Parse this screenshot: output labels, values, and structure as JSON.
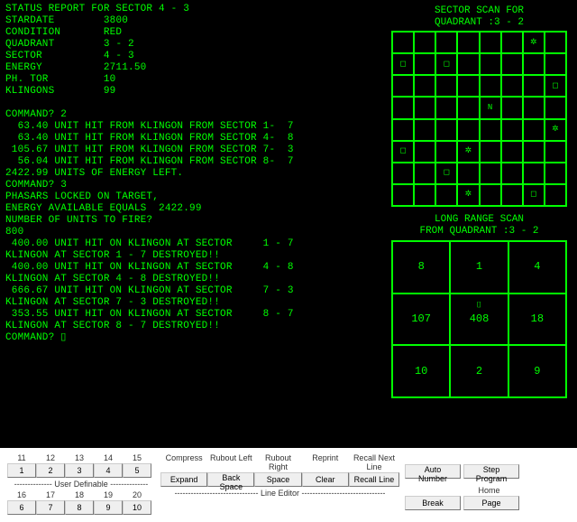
{
  "report": {
    "header": "STATUS REPORT FOR SECTOR 4 - 3",
    "stardate_label": "STARDATE",
    "stardate": "3800",
    "condition_label": "CONDITION",
    "condition": "RED",
    "quadrant_label": "QUADRANT",
    "quadrant": "3 - 2",
    "sector_label": "SECTOR",
    "sector": "4 - 3",
    "energy_label": "ENERGY",
    "energy": "2711.50",
    "phtor_label": "PH. TOR",
    "phtor": "10",
    "klingons_label": "KLINGONS",
    "klingons": "99"
  },
  "log": {
    "cmd1": "COMMAND? 2",
    "hit1": "  63.40 UNIT HIT FROM KLINGON FROM SECTOR 1-  7",
    "hit2": "  63.40 UNIT HIT FROM KLINGON FROM SECTOR 4-  8",
    "hit3": " 105.67 UNIT HIT FROM KLINGON FROM SECTOR 7-  3",
    "hit4": "  56.04 UNIT HIT FROM KLINGON FROM SECTOR 8-  7",
    "energyleft": "2422.99 UNITS OF ENERGY LEFT.",
    "cmd2": "COMMAND? 3",
    "lock": "PHASARS LOCKED ON TARGET,",
    "avail": "ENERGY AVAILABLE EQUALS  2422.99",
    "fireprompt": "NUMBER OF UNITS TO FIRE?",
    "fireval": "800",
    "o1": " 400.00 UNIT HIT ON KLINGON AT SECTOR     1 - 7",
    "d1": "KLINGON AT SECTOR 1 - 7 DESTROYED!!",
    "o2": " 400.00 UNIT HIT ON KLINGON AT SECTOR     4 - 8",
    "d2": "KLINGON AT SECTOR 4 - 8 DESTROYED!!",
    "o3": " 666.67 UNIT HIT ON KLINGON AT SECTOR     7 - 3",
    "d3": "KLINGON AT SECTOR 7 - 3 DESTROYED!!",
    "o4": " 353.55 UNIT HIT ON KLINGON AT SECTOR     8 - 7",
    "d4": "KLINGON AT SECTOR 8 - 7 DESTROYED!!",
    "cmd3_label": "COMMAND? ",
    "cursor": "▯"
  },
  "sector_scan": {
    "title1": "SECTOR SCAN FOR",
    "title2": "QUADRANT :3 - 2",
    "cells": {
      "r1c7": "✲",
      "r2c1": "◻",
      "r2c3": "◻",
      "r3c8": "◻",
      "r4c5": "N",
      "r5c8": "✲",
      "r6c1": "◻",
      "r6c4": "✲",
      "r7c3": "◻",
      "r8c4": "✲",
      "r8c7": "◻"
    }
  },
  "long_range": {
    "title1": "LONG RANGE SCAN",
    "title2": "FROM QUADRANT :3 - 2",
    "cells": [
      "8",
      "1",
      "4",
      "107",
      "408",
      "18",
      "10",
      "2",
      "9"
    ],
    "ship_marker": "⌷"
  },
  "keypad": {
    "top_labels": [
      "11",
      "12",
      "13",
      "14",
      "15"
    ],
    "top_buttons": [
      "1",
      "2",
      "3",
      "4",
      "5"
    ],
    "sep": "-------------- User Definable --------------",
    "bot_labels": [
      "16",
      "17",
      "18",
      "19",
      "20"
    ],
    "bot_buttons": [
      "6",
      "7",
      "8",
      "9",
      "10"
    ]
  },
  "editor": {
    "top_labels": [
      "Compress",
      "Rubout Left",
      "Rubout Right",
      "Reprint",
      "Recall Next Line"
    ],
    "buttons": [
      "Expand",
      "Back Space",
      "Space",
      "Clear",
      "Recall Line"
    ],
    "sep": "------------------------------- Line Editor -------------------------------"
  },
  "right_buttons": {
    "auto": "Auto Number",
    "step": "Step Program",
    "home_lbl": "Home",
    "break": "Break",
    "page": "Page"
  }
}
